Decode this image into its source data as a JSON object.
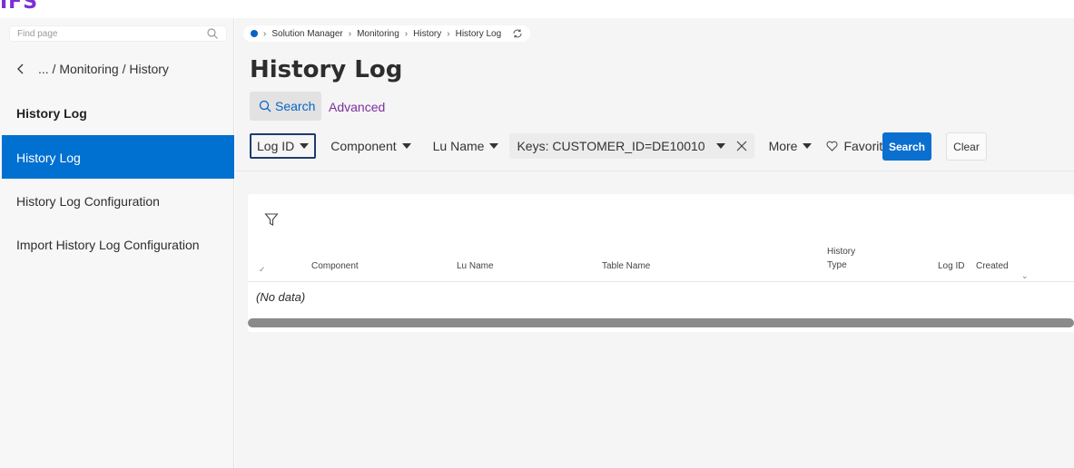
{
  "brand": {
    "logo_text": "IFS",
    "color": "#7b2fd6"
  },
  "sidebar": {
    "search_placeholder": "Find page",
    "back_path": "... / Monitoring / History",
    "heading": "History Log",
    "items": [
      {
        "label": "History Log",
        "active": true
      },
      {
        "label": "History Log Configuration",
        "active": false
      },
      {
        "label": "Import History Log Configuration",
        "active": false
      }
    ]
  },
  "breadcrumb": [
    "Solution Manager",
    "Monitoring",
    "History",
    "History Log"
  ],
  "page": {
    "title": "History Log",
    "tabs": {
      "search": "Search",
      "advanced": "Advanced"
    }
  },
  "filters": {
    "items": [
      "Log ID",
      "Component",
      "Lu Name"
    ],
    "key_chip": "Keys: CUSTOMER_ID=DE10010",
    "more": "More",
    "favorites": "Favorites",
    "search_button": "Search",
    "clear_button": "Clear"
  },
  "table": {
    "columns": {
      "component": "Component",
      "lu_name": "Lu Name",
      "table_name": "Table Name",
      "history_type_line1": "History",
      "history_type_line2": "Type",
      "log_id": "Log ID",
      "created": "Created"
    },
    "empty_text": "(No data)"
  },
  "colors": {
    "accent": "#0070d1",
    "advanced": "#7b2f9e"
  }
}
